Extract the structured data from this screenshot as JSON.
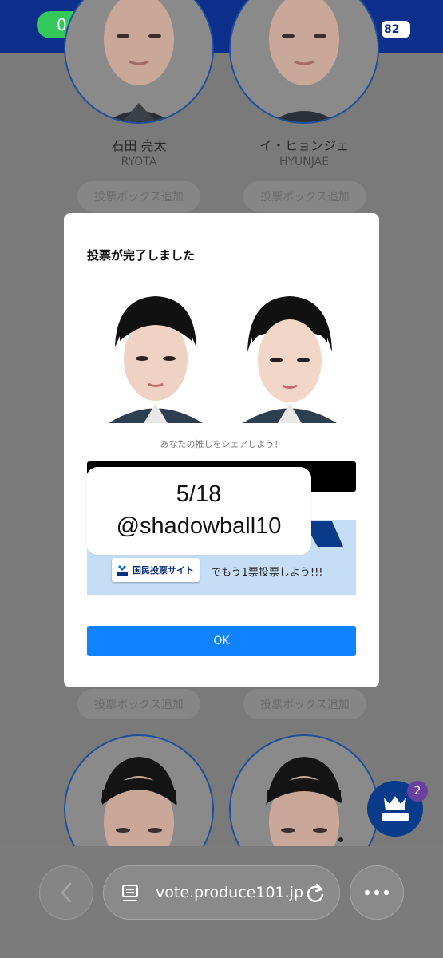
{
  "status_bar": {
    "time": "0:05",
    "battery": "82"
  },
  "candidates_top": [
    {
      "name": "石田 亮太",
      "roman": "RYOTA",
      "button": "投票ボックス追加"
    },
    {
      "name": "イ・ヒョンジェ",
      "roman": "HYUNJAE",
      "button": "投票ボックス追加"
    }
  ],
  "candidates_bottom": [
    {
      "button": "投票ボックス追加"
    },
    {
      "button": "投票ボックス追加"
    }
  ],
  "modal": {
    "title": "投票が完了しました",
    "share_prompt": "あなたの推しをシェアしよう！",
    "site_logo_text": "国民投票サイト",
    "vote_more_text": "でもう1票投票しよう!!!",
    "ok_label": "OK"
  },
  "sticker": {
    "line1": "5/18",
    "line2": "@shadowball10"
  },
  "vote_box_badge": "2",
  "browser": {
    "url": "vote.produce101.jp"
  },
  "colors": {
    "status_bar": "#0b2f8a",
    "time_pill": "#34c759",
    "ok_button": "#0f83ff",
    "overlay_bg": "#7a7a7a"
  }
}
